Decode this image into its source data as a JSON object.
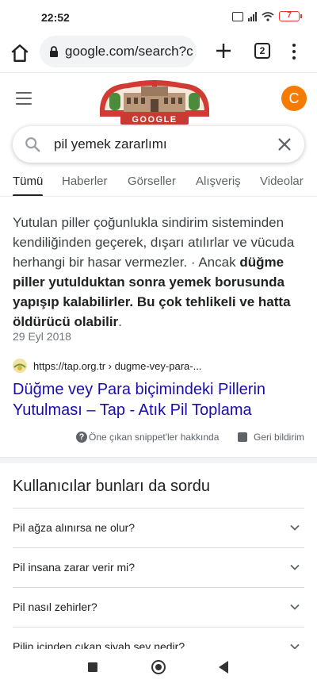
{
  "status_bar": {
    "time": "22:52",
    "battery": "7"
  },
  "browser": {
    "url": "google.com/search?c",
    "tab_count": "2"
  },
  "google": {
    "doodle_text": "GOOGLE",
    "avatar_letter": "C"
  },
  "search": {
    "query": "pil yemek zararlımı"
  },
  "tabs": [
    "Tümü",
    "Haberler",
    "Görseller",
    "Alışveriş",
    "Videolar"
  ],
  "snippet": {
    "text_plain": "Yutulan piller çoğunlukla sindirim sisteminden kendiliğinden geçerek, dışarı atılırlar ve vücuda herhangi bir hasar vermezler. · Ancak ",
    "text_bold": "düğme piller yutulduktan sonra yemek borusunda yapışıp kalabilirler. Bu çok tehlikeli ve hatta öldürücü olabilir",
    "text_end": ".",
    "date": "29 Eyl 2018",
    "source_url": "https://tap.org.tr › dugme-vey-para-...",
    "result_title": "Düğme vey Para biçimindeki Pillerin Yutulması – Tap - Atık Pil Toplama",
    "about_label": "Öne çıkan snippet'ler hakkında",
    "feedback_label": "Geri bildirim"
  },
  "paa": {
    "title": "Kullanıcılar bunları da sordu",
    "questions": [
      "Pil ağza alınırsa ne olur?",
      "Pil insana zarar verir mi?",
      "Pil nasıl zehirler?",
      "Pilin içinden çıkan siyah şey nedir?"
    ]
  },
  "colors": {
    "link": "#1a0dab",
    "avatar": "#f57c00",
    "battery": "#e33333"
  },
  "icons": [
    "home-icon",
    "lock-icon",
    "plus-icon",
    "tabs-icon",
    "more-icon",
    "menu-icon",
    "search-icon",
    "close-icon",
    "help-icon",
    "feedback-icon",
    "chevron-down-icon"
  ]
}
